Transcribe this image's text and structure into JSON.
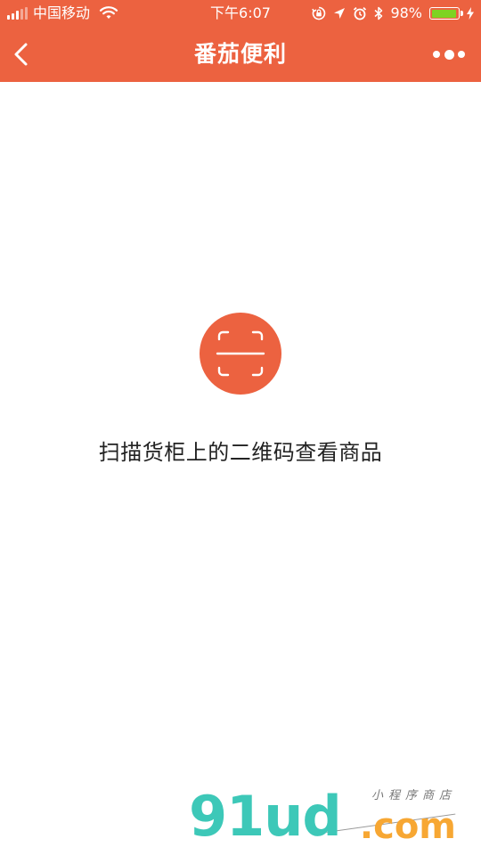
{
  "status_bar": {
    "carrier": "中国移动",
    "time": "下午6:07",
    "battery": "98%",
    "battery_level": 0.98,
    "icons": [
      "signal-icon",
      "wifi-icon",
      "orientation-lock-icon",
      "location-icon",
      "alarm-icon",
      "bluetooth-icon",
      "battery-icon",
      "charging-icon"
    ]
  },
  "nav": {
    "title": "番茄便利",
    "back_icon": "chevron-left-icon",
    "more_icon": "more-dots-icon"
  },
  "main": {
    "scan_icon": "scan-icon",
    "hint": "扫描货柜上的二维码查看商品"
  },
  "watermark": {
    "logo": "91ud",
    "domain": ".com",
    "tagline": "小程序商店"
  },
  "colors": {
    "accent": "#ec6240",
    "battery_fill": "#7ed321",
    "watermark_logo": "#3dc8b8",
    "watermark_com": "#f7a733"
  }
}
